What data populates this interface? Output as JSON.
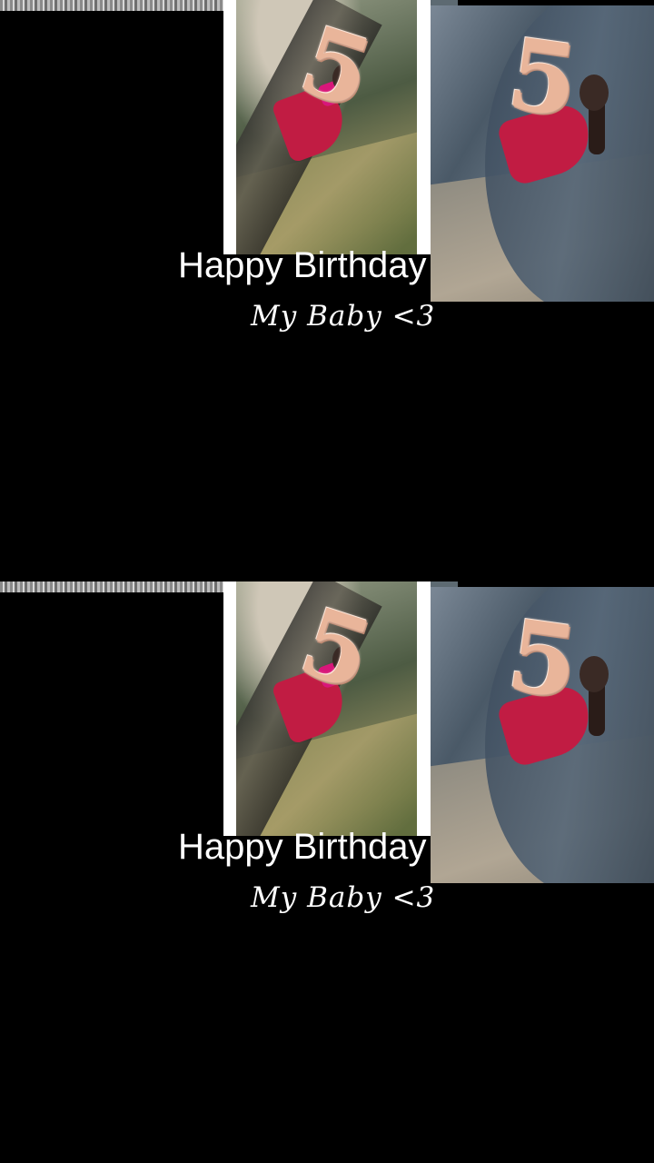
{
  "frames": [
    {
      "title": "Happy Birthday",
      "subtitle": "My Baby <3",
      "balloon_number": "5"
    },
    {
      "title": "Happy Birthday",
      "subtitle": "My Baby <3",
      "balloon_number": "5"
    }
  ],
  "colors": {
    "background": "#000000",
    "text": "#ffffff",
    "dress": "#c11c43",
    "balloon": "#e9b59a"
  }
}
